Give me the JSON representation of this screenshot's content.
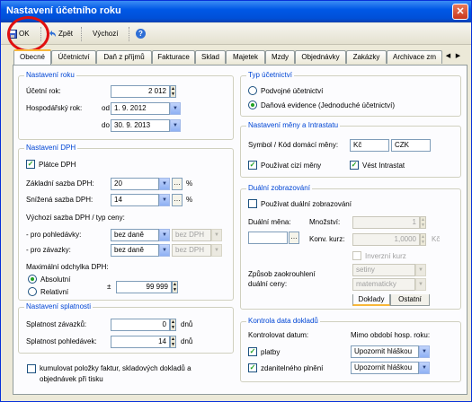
{
  "window": {
    "title": "Nastavení účetního roku",
    "close": "✕"
  },
  "toolbar": {
    "ok": "OK",
    "back": "Zpět",
    "default": "Výchozí",
    "help": "?"
  },
  "tabs": [
    "Obecné",
    "Účetnictví",
    "Daň z příjmů",
    "Fakturace",
    "Sklad",
    "Majetek",
    "Mzdy",
    "Objednávky",
    "Zakázky",
    "Archivace zm"
  ],
  "tab_arrows": [
    "◀",
    "▶"
  ],
  "year": {
    "title": "Nastavení roku",
    "fiscal_year_label": "Účetní rok:",
    "fiscal_year_value": "2 012",
    "econ_year_label": "Hospodářský rok:",
    "from_label": "od",
    "from_value": " 1. 9. 2012",
    "to_label": "do",
    "to_value": "30. 9. 2013"
  },
  "vat": {
    "title": "Nastavení DPH",
    "payer_label": "Plátce DPH",
    "payer_checked": true,
    "basic_rate_label": "Základní sazba DPH:",
    "basic_rate_value": "20",
    "reduced_rate_label": "Snížená sazba DPH:",
    "reduced_rate_value": "14",
    "percent": "%",
    "ellipsis": "…",
    "default_rate_label": "Výchozí sazba DPH / typ ceny:",
    "receivables_label": "- pro pohledávky:",
    "receivables_rate": "bez daně",
    "receivables_price": "bez DPH",
    "payables_label": "- pro závazky:",
    "payables_rate": "bez daně",
    "payables_price": "bez DPH",
    "max_dev_label": "Maximální odchylka DPH:",
    "absolute_label": "Absolutní",
    "absolute_selected": true,
    "relative_label": "Relativní",
    "plusminus": "±",
    "dev_value": "99 999"
  },
  "due": {
    "title": "Nastavení splatnosti",
    "payables_label": "Splatnost závazků:",
    "payables_value": "0",
    "receivables_label": "Splatnost pohledávek:",
    "receivables_value": "14",
    "unit": "dnů"
  },
  "cumulate": {
    "label_line1": "kumulovat položky faktur, skladových dokladů a",
    "label_line2": "objednávek při tisku",
    "checked": false
  },
  "accounting": {
    "title": "Typ účetnictví",
    "double_entry": "Podvojné účetnictví",
    "tax_records": "Daňová evidence (Jednoduché účetnictví)",
    "selected": "tax_records"
  },
  "currency": {
    "title": "Nastavení měny a Intrastatu",
    "symbol_label": "Symbol / Kód domácí měny:",
    "symbol_value": "Kč",
    "code_value": "CZK",
    "foreign_label": "Používat cizí měny",
    "foreign_checked": true,
    "intrastat_label": "Vést Intrastat",
    "intrastat_checked": true
  },
  "dual": {
    "title": "Duální zobrazování",
    "use_label": "Používat duální zobrazování",
    "use_checked": false,
    "currency_label": "Duální měna:",
    "qty_label": "Množství:",
    "qty_value": "1",
    "rate_label": "Konv. kurz:",
    "rate_value": "1,0000",
    "rate_unit": "Kč",
    "inverse_label": "Inverzní kurz",
    "rounding_label_line1": "Způsob zaokrouhlení",
    "rounding_label_line2": "duální ceny:",
    "rounding_units": "setiny",
    "rounding_method": "matematicky",
    "subtab_docs": "Doklady",
    "subtab_other": "Ostatní"
  },
  "control": {
    "title": "Kontrola data dokladů",
    "check_dates_label": "Kontrolovat datum:",
    "outside_period_label": "Mimo období hosp. roku:",
    "payments_label": "platby",
    "payments_checked": true,
    "payments_value": "Upozornit hláškou",
    "taxable_label": "zdanitelného plnění",
    "taxable_checked": true,
    "taxable_value": "Upozornit hláškou"
  },
  "icons": {
    "dropdown": "▼",
    "spin_up": "▲",
    "spin_down": "▼",
    "check": "✓"
  }
}
